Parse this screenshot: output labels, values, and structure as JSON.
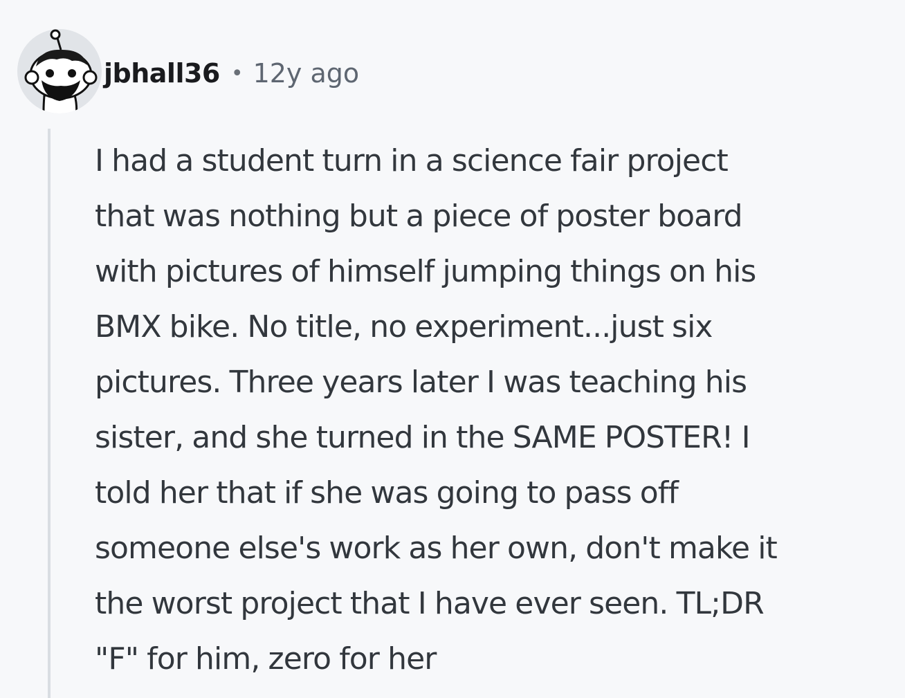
{
  "comment": {
    "author": "jbhall36",
    "separator": "•",
    "time_ago": "12y ago",
    "body_lines": [
      "I had a student turn in a science fair project",
      "that was nothing but a piece of poster board",
      "with pictures of himself jumping things on his",
      "BMX bike. No title, no experiment...just six",
      "pictures. Three years later I was teaching his",
      "sister, and she turned in the SAME POSTER! I",
      "told her that if she was going to pass off",
      "someone else's work as her own, don't make it",
      "the worst project that I have ever seen. TL;DR",
      "\"F\" for him, zero for her"
    ]
  },
  "colors": {
    "background": "#f7f8fa",
    "thread_line": "#d9dde2",
    "author": "#1a1b1e",
    "meta": "#5e6671",
    "body_text": "#32373d"
  },
  "icons": {
    "avatar": "snoo-avatar-icon"
  }
}
